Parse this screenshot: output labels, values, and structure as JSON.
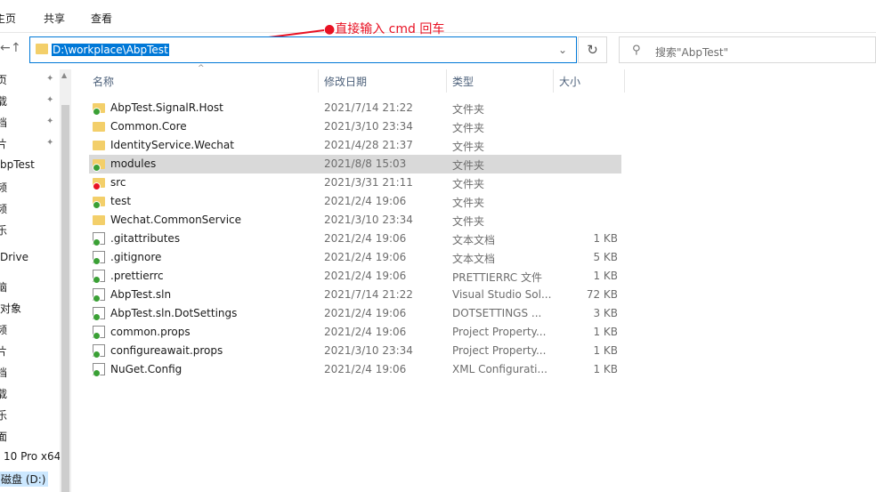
{
  "ribbon": {
    "tab_home": "主页",
    "tab_share": "共享",
    "tab_view": "查看"
  },
  "annotation": {
    "text": "●直接输入 cmd  回车",
    "color": "#e81123"
  },
  "address": {
    "path": "D:\\workplace\\AbpTest"
  },
  "search": {
    "placeholder": "搜索\"AbpTest\""
  },
  "nav": {
    "items": [
      "页",
      "载",
      "档",
      "片",
      "bpTest",
      "频",
      "频",
      "乐",
      "Drive",
      "脑",
      "对象",
      "频",
      "片",
      "档",
      "载",
      "乐",
      "面",
      "10 Pro x64",
      "磁盘 (D:)"
    ]
  },
  "columns": {
    "name": "名称",
    "date": "修改日期",
    "type": "类型",
    "size": "大小"
  },
  "files": [
    {
      "name": "AbpTest.SignalR.Host",
      "date": "2021/7/14 21:22",
      "type": "文件夹",
      "size": "",
      "icon": "folder-icon",
      "status": "ok"
    },
    {
      "name": "Common.Core",
      "date": "2021/3/10 23:34",
      "type": "文件夹",
      "size": "",
      "icon": "folder-icon",
      "status": "none"
    },
    {
      "name": "IdentityService.Wechat",
      "date": "2021/4/28 21:37",
      "type": "文件夹",
      "size": "",
      "icon": "folder-icon",
      "status": "none"
    },
    {
      "name": "modules",
      "date": "2021/8/8 15:03",
      "type": "文件夹",
      "size": "",
      "icon": "folder-icon",
      "status": "ok",
      "selected": true
    },
    {
      "name": "src",
      "date": "2021/3/31 21:11",
      "type": "文件夹",
      "size": "",
      "icon": "folder-icon",
      "status": "err"
    },
    {
      "name": "test",
      "date": "2021/2/4 19:06",
      "type": "文件夹",
      "size": "",
      "icon": "folder-icon",
      "status": "ok"
    },
    {
      "name": "Wechat.CommonService",
      "date": "2021/3/10 23:34",
      "type": "文件夹",
      "size": "",
      "icon": "folder-icon",
      "status": "none"
    },
    {
      "name": ".gitattributes",
      "date": "2021/2/4 19:06",
      "type": "文本文档",
      "size": "1 KB",
      "icon": "document-icon",
      "status": "ok"
    },
    {
      "name": ".gitignore",
      "date": "2021/2/4 19:06",
      "type": "文本文档",
      "size": "5 KB",
      "icon": "document-icon",
      "status": "ok"
    },
    {
      "name": ".prettierrc",
      "date": "2021/2/4 19:06",
      "type": "PRETTIERRC 文件",
      "size": "1 KB",
      "icon": "document-icon",
      "status": "ok"
    },
    {
      "name": "AbpTest.sln",
      "date": "2021/7/14 21:22",
      "type": "Visual Studio Sol...",
      "size": "72 KB",
      "icon": "solution-icon",
      "status": "ok"
    },
    {
      "name": "AbpTest.sln.DotSettings",
      "date": "2021/2/4 19:06",
      "type": "DOTSETTINGS ...",
      "size": "3 KB",
      "icon": "document-icon",
      "status": "ok"
    },
    {
      "name": "common.props",
      "date": "2021/2/4 19:06",
      "type": "Project Property...",
      "size": "1 KB",
      "icon": "document-icon",
      "status": "ok"
    },
    {
      "name": "configureawait.props",
      "date": "2021/3/10 23:34",
      "type": "Project Property...",
      "size": "1 KB",
      "icon": "document-icon",
      "status": "ok"
    },
    {
      "name": "NuGet.Config",
      "date": "2021/2/4 19:06",
      "type": "XML Configurati...",
      "size": "1 KB",
      "icon": "document-icon",
      "status": "ok"
    }
  ]
}
